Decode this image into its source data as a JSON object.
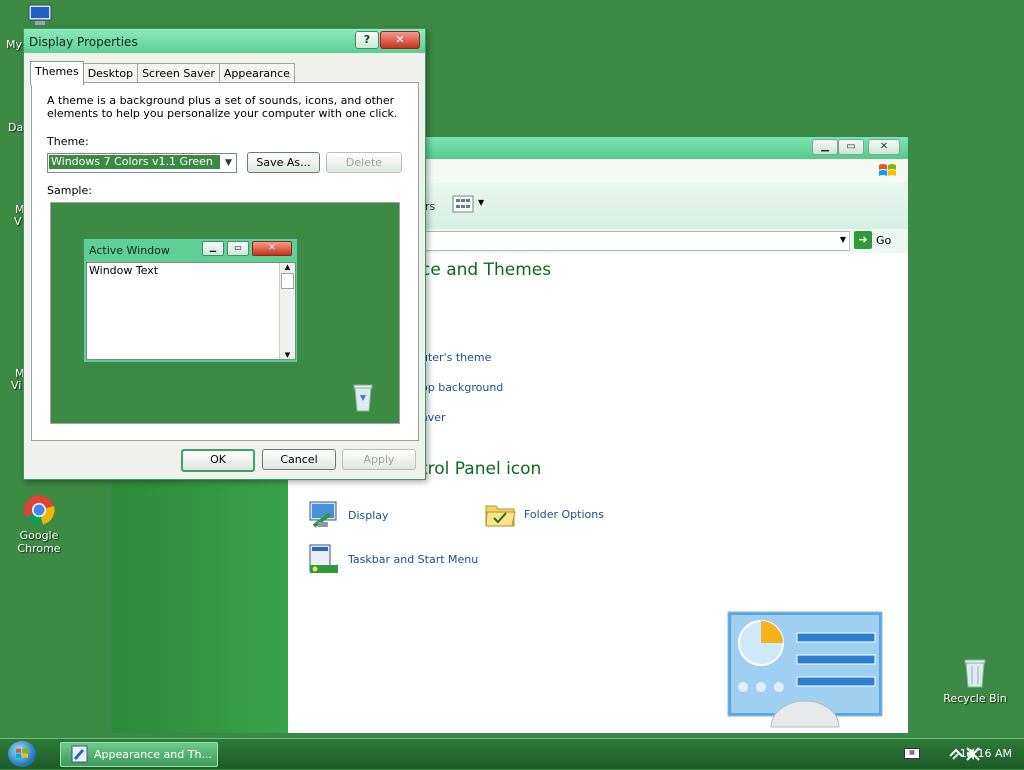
{
  "desktop": {
    "icons": [
      {
        "label": "Google\nChrome"
      },
      {
        "label": "Recycle Bin"
      }
    ],
    "clipped_labels": [
      "My",
      "Da",
      "M",
      "V",
      "M",
      "Vi"
    ]
  },
  "control_panel": {
    "address_go": "Go",
    "toolbar_views_partial": "rs",
    "heading_partial": "ce and Themes",
    "task_links": [
      "uter's theme",
      "op background",
      "aver"
    ],
    "icon_heading_partial": "trol Panel icon",
    "icons": [
      {
        "label": "Display"
      },
      {
        "label": "Folder Options"
      },
      {
        "label": "Taskbar and Start Menu"
      }
    ]
  },
  "dialog": {
    "title": "Display Properties",
    "help": "?",
    "tabs": [
      "Themes",
      "Desktop",
      "Screen Saver",
      "Appearance"
    ],
    "description": "A theme is a background plus a set of sounds, icons, and other elements to help you personalize your computer with one click.",
    "theme_label": "Theme:",
    "theme_value": "Windows 7 Colors v1.1 Green",
    "save_as": "Save As...",
    "delete": "Delete",
    "sample_label": "Sample:",
    "sample": {
      "window_title": "Active Window",
      "window_text": "Window Text"
    },
    "ok": "OK",
    "cancel": "Cancel",
    "apply": "Apply"
  },
  "taskbar": {
    "task_title": "Appearance and Th...",
    "clock": "12:16 AM"
  },
  "colors": {
    "desktop": "#3d8a45",
    "title_green": "#5fcf94",
    "link_blue": "#1b4f8a",
    "heading_green": "#0a6b1a"
  }
}
